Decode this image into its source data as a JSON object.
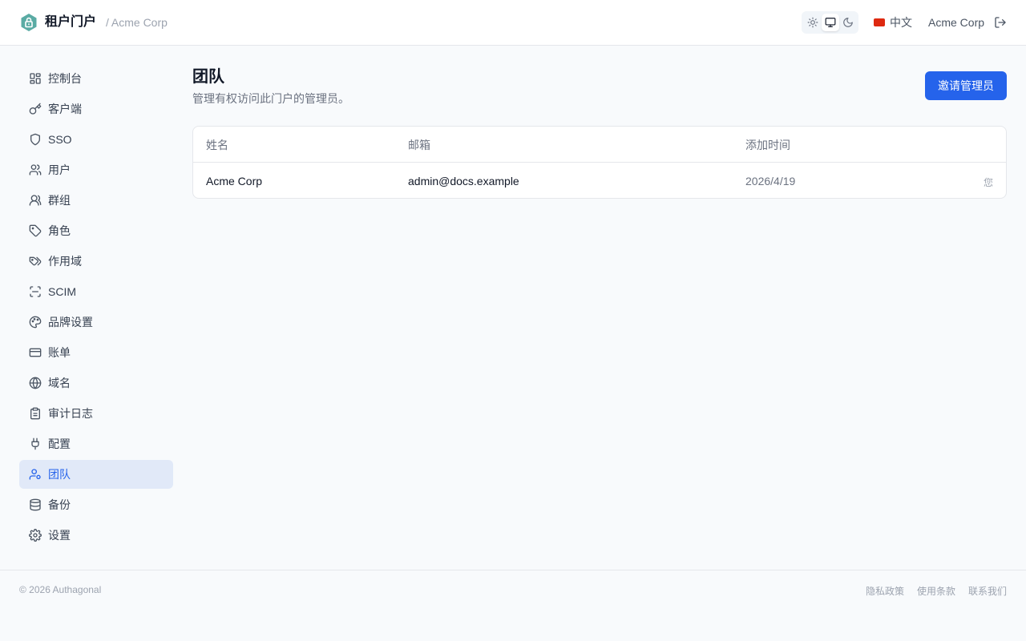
{
  "header": {
    "app_title": "租户门户",
    "crumb_sep": "/",
    "tenant": "Acme Corp",
    "theme_options": [
      "light-icon",
      "system-icon",
      "dark-icon"
    ],
    "theme_selected": "system",
    "language": "中文",
    "org_name": "Acme Corp"
  },
  "sidebar": {
    "items": [
      {
        "label": "控制台",
        "icon": "dashboard-icon"
      },
      {
        "label": "客户端",
        "icon": "key-icon"
      },
      {
        "label": "SSO",
        "icon": "shield-icon"
      },
      {
        "label": "用户",
        "icon": "users-icon"
      },
      {
        "label": "群组",
        "icon": "group-icon"
      },
      {
        "label": "角色",
        "icon": "tag-icon"
      },
      {
        "label": "作用域",
        "icon": "tags-icon"
      },
      {
        "label": "SCIM",
        "icon": "scan-icon"
      },
      {
        "label": "品牌设置",
        "icon": "palette-icon"
      },
      {
        "label": "账单",
        "icon": "credit-card-icon"
      },
      {
        "label": "域名",
        "icon": "globe-icon"
      },
      {
        "label": "审计日志",
        "icon": "clipboard-icon"
      },
      {
        "label": "配置",
        "icon": "plug-icon"
      },
      {
        "label": "团队",
        "icon": "user-cog-icon"
      },
      {
        "label": "备份",
        "icon": "database-icon"
      },
      {
        "label": "设置",
        "icon": "gear-icon"
      }
    ],
    "active": "团队"
  },
  "main": {
    "title": "团队",
    "subtitle": "管理有权访问此门户的管理员。",
    "invite_label": "邀请管理员",
    "table": {
      "columns": [
        "姓名",
        "邮箱",
        "添加时间"
      ],
      "rows": [
        {
          "name": "Acme Corp",
          "email": "admin@docs.example",
          "added": "2026/4/19",
          "badge": "您"
        }
      ]
    }
  },
  "footer": {
    "copyright": "© 2026 Authagonal",
    "links": [
      "隐私政策",
      "使用条款",
      "联系我们"
    ]
  },
  "colors": {
    "accent": "#2563eb",
    "active_nav_bg": "#e1e9f8",
    "logo": "#5aaba4"
  }
}
